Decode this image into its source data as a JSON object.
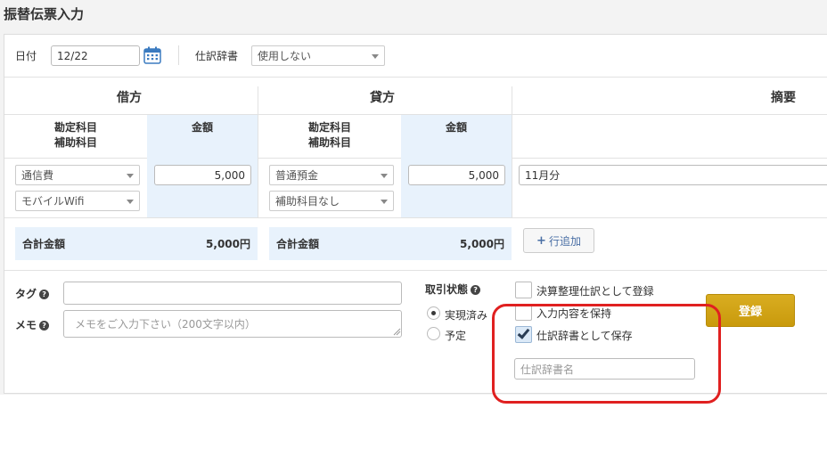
{
  "page": {
    "title": "振替伝票入力"
  },
  "header": {
    "date_label": "日付",
    "date_value": "12/22",
    "dict_label": "仕訳辞書",
    "dict_value": "使用しない"
  },
  "table": {
    "debit_header": "借方",
    "credit_header": "貸方",
    "memo_header": "摘要",
    "account_col_line1": "勘定科目",
    "account_col_line2": "補助科目",
    "amount_col": "金額",
    "debit": {
      "account": "通信費",
      "sub_account": "モバイルWifi",
      "amount": "5,000"
    },
    "credit": {
      "account": "普通預金",
      "sub_account": "補助科目なし",
      "amount": "5,000"
    },
    "memo_value": "11月分",
    "total_label": "合計金額",
    "debit_total": "5,000円",
    "credit_total": "5,000円",
    "add_row_label": "行追加"
  },
  "footer": {
    "tag_label": "タグ",
    "memo_label": "メモ",
    "memo_placeholder": "メモをご入力下さい（200文字以内）",
    "status_label": "取引状態",
    "status_options": [
      "実現済み",
      "予定"
    ],
    "status_selected": "実現済み",
    "checkboxes": [
      {
        "label": "決算整理仕訳として登録",
        "checked": false
      },
      {
        "label": "入力内容を保持",
        "checked": false
      },
      {
        "label": "仕訳辞書として保存",
        "checked": true
      }
    ],
    "dict_name_placeholder": "仕訳辞書名",
    "register_label": "登録"
  },
  "colors": {
    "highlight": "#e02020",
    "register": "#d4a415",
    "total_bg": "#e8f2fc"
  }
}
